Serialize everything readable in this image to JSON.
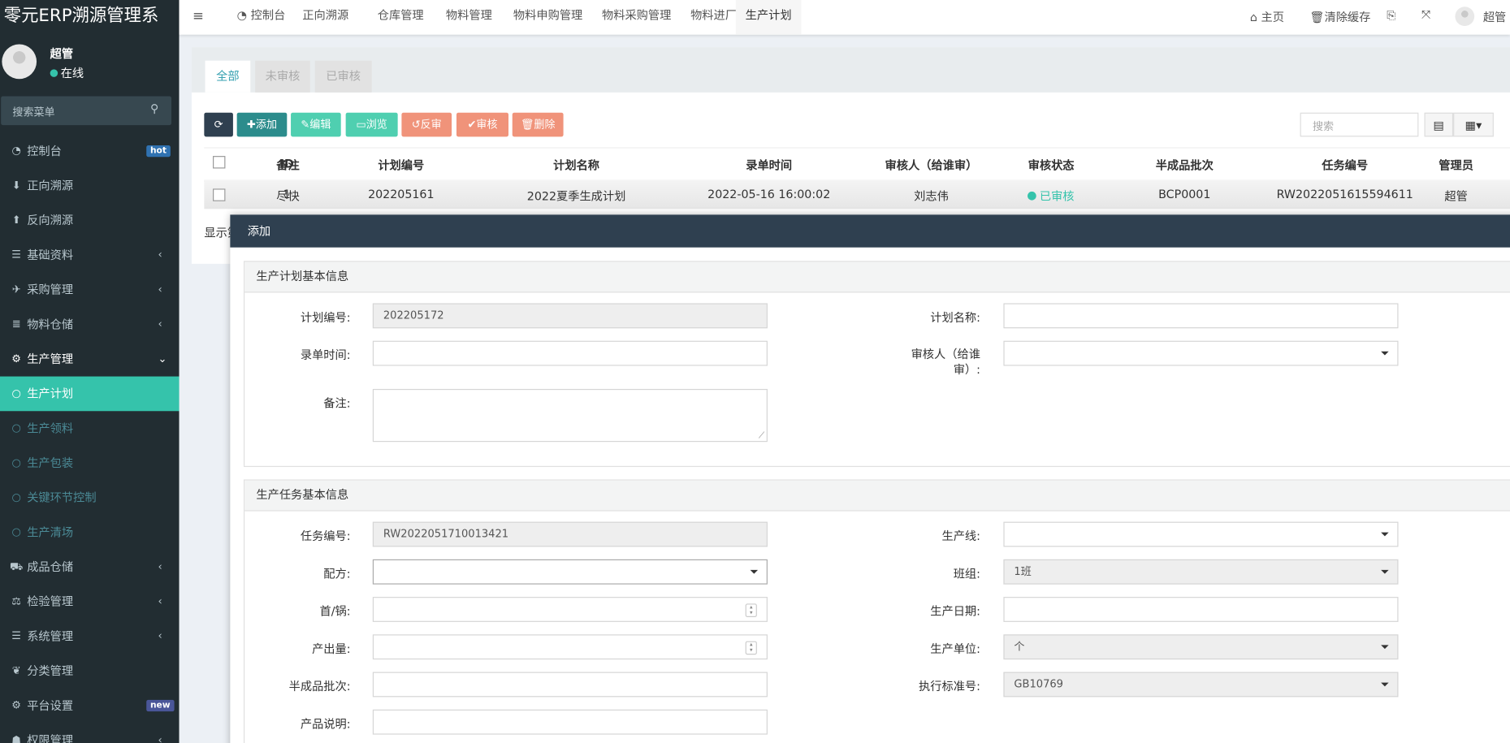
{
  "app_title": "零元ERP溯源管理系",
  "user": {
    "name": "超管",
    "status": "在线"
  },
  "sidebar": {
    "search_placeholder": "搜索菜单",
    "items": [
      {
        "label": "控制台",
        "icon": "dashboard-icon",
        "badge": "hot",
        "badge_color": "#3072b1"
      },
      {
        "label": "正向溯源",
        "icon": "arrow-down-icon"
      },
      {
        "label": "反向溯源",
        "icon": "arrow-up-icon"
      },
      {
        "label": "基础资料",
        "icon": "list-icon",
        "arrow": "‹"
      },
      {
        "label": "采购管理",
        "icon": "plane-icon",
        "arrow": "‹"
      },
      {
        "label": "物料仓储",
        "icon": "database-icon",
        "arrow": "‹"
      },
      {
        "label": "生产管理",
        "icon": "cogs-icon",
        "arrow": "⌄"
      },
      {
        "label": "生产计划",
        "icon": "circle-icon"
      },
      {
        "label": "生产领料",
        "icon": "circle-icon"
      },
      {
        "label": "生产包装",
        "icon": "circle-icon"
      },
      {
        "label": "关键环节控制",
        "icon": "circle-icon"
      },
      {
        "label": "生产清场",
        "icon": "circle-icon"
      },
      {
        "label": "成品仓储",
        "icon": "binoculars-icon",
        "arrow": "‹"
      },
      {
        "label": "检验管理",
        "icon": "balance-icon",
        "arrow": "‹"
      },
      {
        "label": "系统管理",
        "icon": "list-icon",
        "arrow": "‹"
      },
      {
        "label": "分类管理",
        "icon": "leaf-icon"
      },
      {
        "label": "平台设置",
        "icon": "cogs-icon",
        "badge": "new",
        "badge_color": "#4a5699"
      },
      {
        "label": "权限管理",
        "icon": "users-icon",
        "arrow": "‹"
      }
    ]
  },
  "topbar": {
    "tabs": [
      "控制台",
      "正向溯源",
      "仓库管理",
      "物料管理",
      "物料申购管理",
      "物料采购管理",
      "物料进厂",
      "生产计划"
    ],
    "home": "主页",
    "clear_cache": "清除缓存",
    "user": "超管"
  },
  "panel": {
    "tabs": [
      "全部",
      "未审核",
      "已审核"
    ],
    "buttons": [
      "添加",
      "编辑",
      "浏览",
      "反审",
      "审核",
      "删除"
    ],
    "search_placeholder": "搜索",
    "columns": [
      "ID",
      "计划编号",
      "计划名称",
      "录单时间",
      "审核人（给谁审）",
      "审核状态",
      "半成品批次",
      "任务编号",
      "管理员",
      "备注"
    ],
    "rows": [
      [
        "1",
        "202205161",
        "2022夏季生成计划",
        "2022-05-16 16:00:02",
        "刘志伟",
        "已审核",
        "BCP0001",
        "RW2022051615594611",
        "超管",
        "尽快"
      ]
    ],
    "footer": "显示第"
  },
  "modal": {
    "title": "添加",
    "section1": {
      "title": "生产计划基本信息",
      "plan_no_label": "计划编号:",
      "plan_no": "202205172",
      "plan_name_label": "计划名称:",
      "time_label": "录单时间:",
      "reviewer_label": "审核人（给谁审）:",
      "remark_label": "备注:"
    },
    "section2": {
      "title": "生产任务基本信息",
      "task_no_label": "任务编号:",
      "task_no": "RW2022051710013421",
      "line_label": "生产线:",
      "formula_label": "配方:",
      "team_label": "班组:",
      "team": "1班",
      "per_pot_label": "首/锅:",
      "date_label": "生产日期:",
      "output_label": "产出量:",
      "unit_label": "生产单位:",
      "unit": "个",
      "batch_label": "半成品批次:",
      "standard_label": "执行标准号:",
      "standard": "GB10769",
      "desc_label": "产品说明:"
    }
  }
}
